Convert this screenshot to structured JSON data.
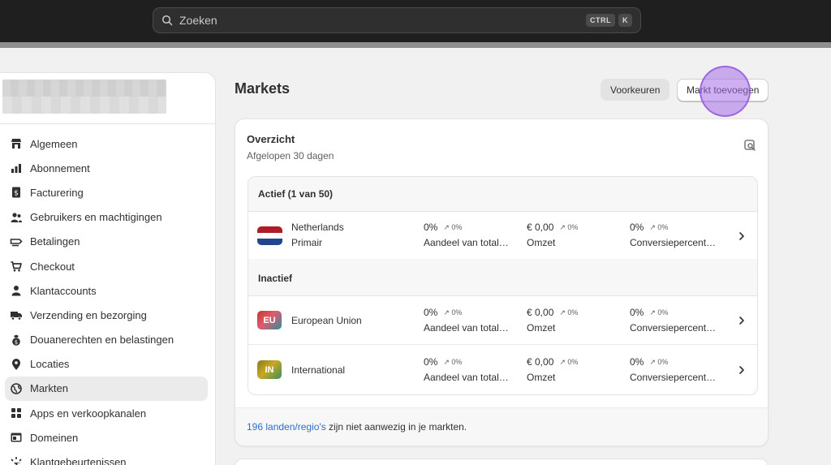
{
  "search": {
    "placeholder": "Zoeken",
    "shortcut_ctrl": "CTRL",
    "shortcut_key": "K"
  },
  "sidebar": {
    "items": [
      {
        "label": "Algemeen",
        "icon": "store-icon"
      },
      {
        "label": "Abonnement",
        "icon": "plan-icon"
      },
      {
        "label": "Facturering",
        "icon": "billing-icon"
      },
      {
        "label": "Gebruikers en machtigingen",
        "icon": "users-icon"
      },
      {
        "label": "Betalingen",
        "icon": "payments-icon"
      },
      {
        "label": "Checkout",
        "icon": "cart-icon"
      },
      {
        "label": "Klantaccounts",
        "icon": "person-icon"
      },
      {
        "label": "Verzending en bezorging",
        "icon": "truck-icon"
      },
      {
        "label": "Douanerechten en belastingen",
        "icon": "taxes-icon"
      },
      {
        "label": "Locaties",
        "icon": "location-icon"
      },
      {
        "label": "Markten",
        "icon": "globe-icon",
        "active": true
      },
      {
        "label": "Apps en verkoopkanalen",
        "icon": "apps-icon"
      },
      {
        "label": "Domeinen",
        "icon": "domain-icon"
      },
      {
        "label": "Klantgebeurtenissen",
        "icon": "events-icon"
      }
    ]
  },
  "main": {
    "title": "Markets",
    "preferences_button": "Voorkeuren",
    "add_market_button": "Markt toevoegen",
    "overview": {
      "title": "Overzicht",
      "subtitle": "Afgelopen 30 dagen",
      "active_header": "Actief (1 van 50)",
      "inactive_header": "Inactief",
      "rows": [
        {
          "name": "Netherlands",
          "sub": "Primair",
          "share": "0%",
          "share_trend": "↗ 0%",
          "share_label": "Aandeel van total…",
          "revenue": "€ 0,00",
          "revenue_trend": "↗ 0%",
          "revenue_label": "Omzet",
          "conversion": "0%",
          "conversion_trend": "↗ 0%",
          "conversion_label": "Conversiepercent…"
        },
        {
          "name": "European Union",
          "badge": "EU",
          "share": "0%",
          "share_trend": "↗ 0%",
          "share_label": "Aandeel van total…",
          "revenue": "€ 0,00",
          "revenue_trend": "↗ 0%",
          "revenue_label": "Omzet",
          "conversion": "0%",
          "conversion_trend": "↗ 0%",
          "conversion_label": "Conversiepercent…"
        },
        {
          "name": "International",
          "badge": "IN",
          "share": "0%",
          "share_trend": "↗ 0%",
          "share_label": "Aandeel van total…",
          "revenue": "€ 0,00",
          "revenue_trend": "↗ 0%",
          "revenue_label": "Omzet",
          "conversion": "0%",
          "conversion_trend": "↗ 0%",
          "conversion_label": "Conversiepercent…"
        }
      ],
      "footer_link": "196 landen/regio's",
      "footer_text": " zijn niet aanwezig in je markten."
    }
  },
  "colors": {
    "topbar": "#1f1f1f",
    "link": "#2c6ecb",
    "cursor_highlight": "#a46ee8",
    "nl_red": "#ae1c28",
    "nl_blue": "#21468b"
  }
}
